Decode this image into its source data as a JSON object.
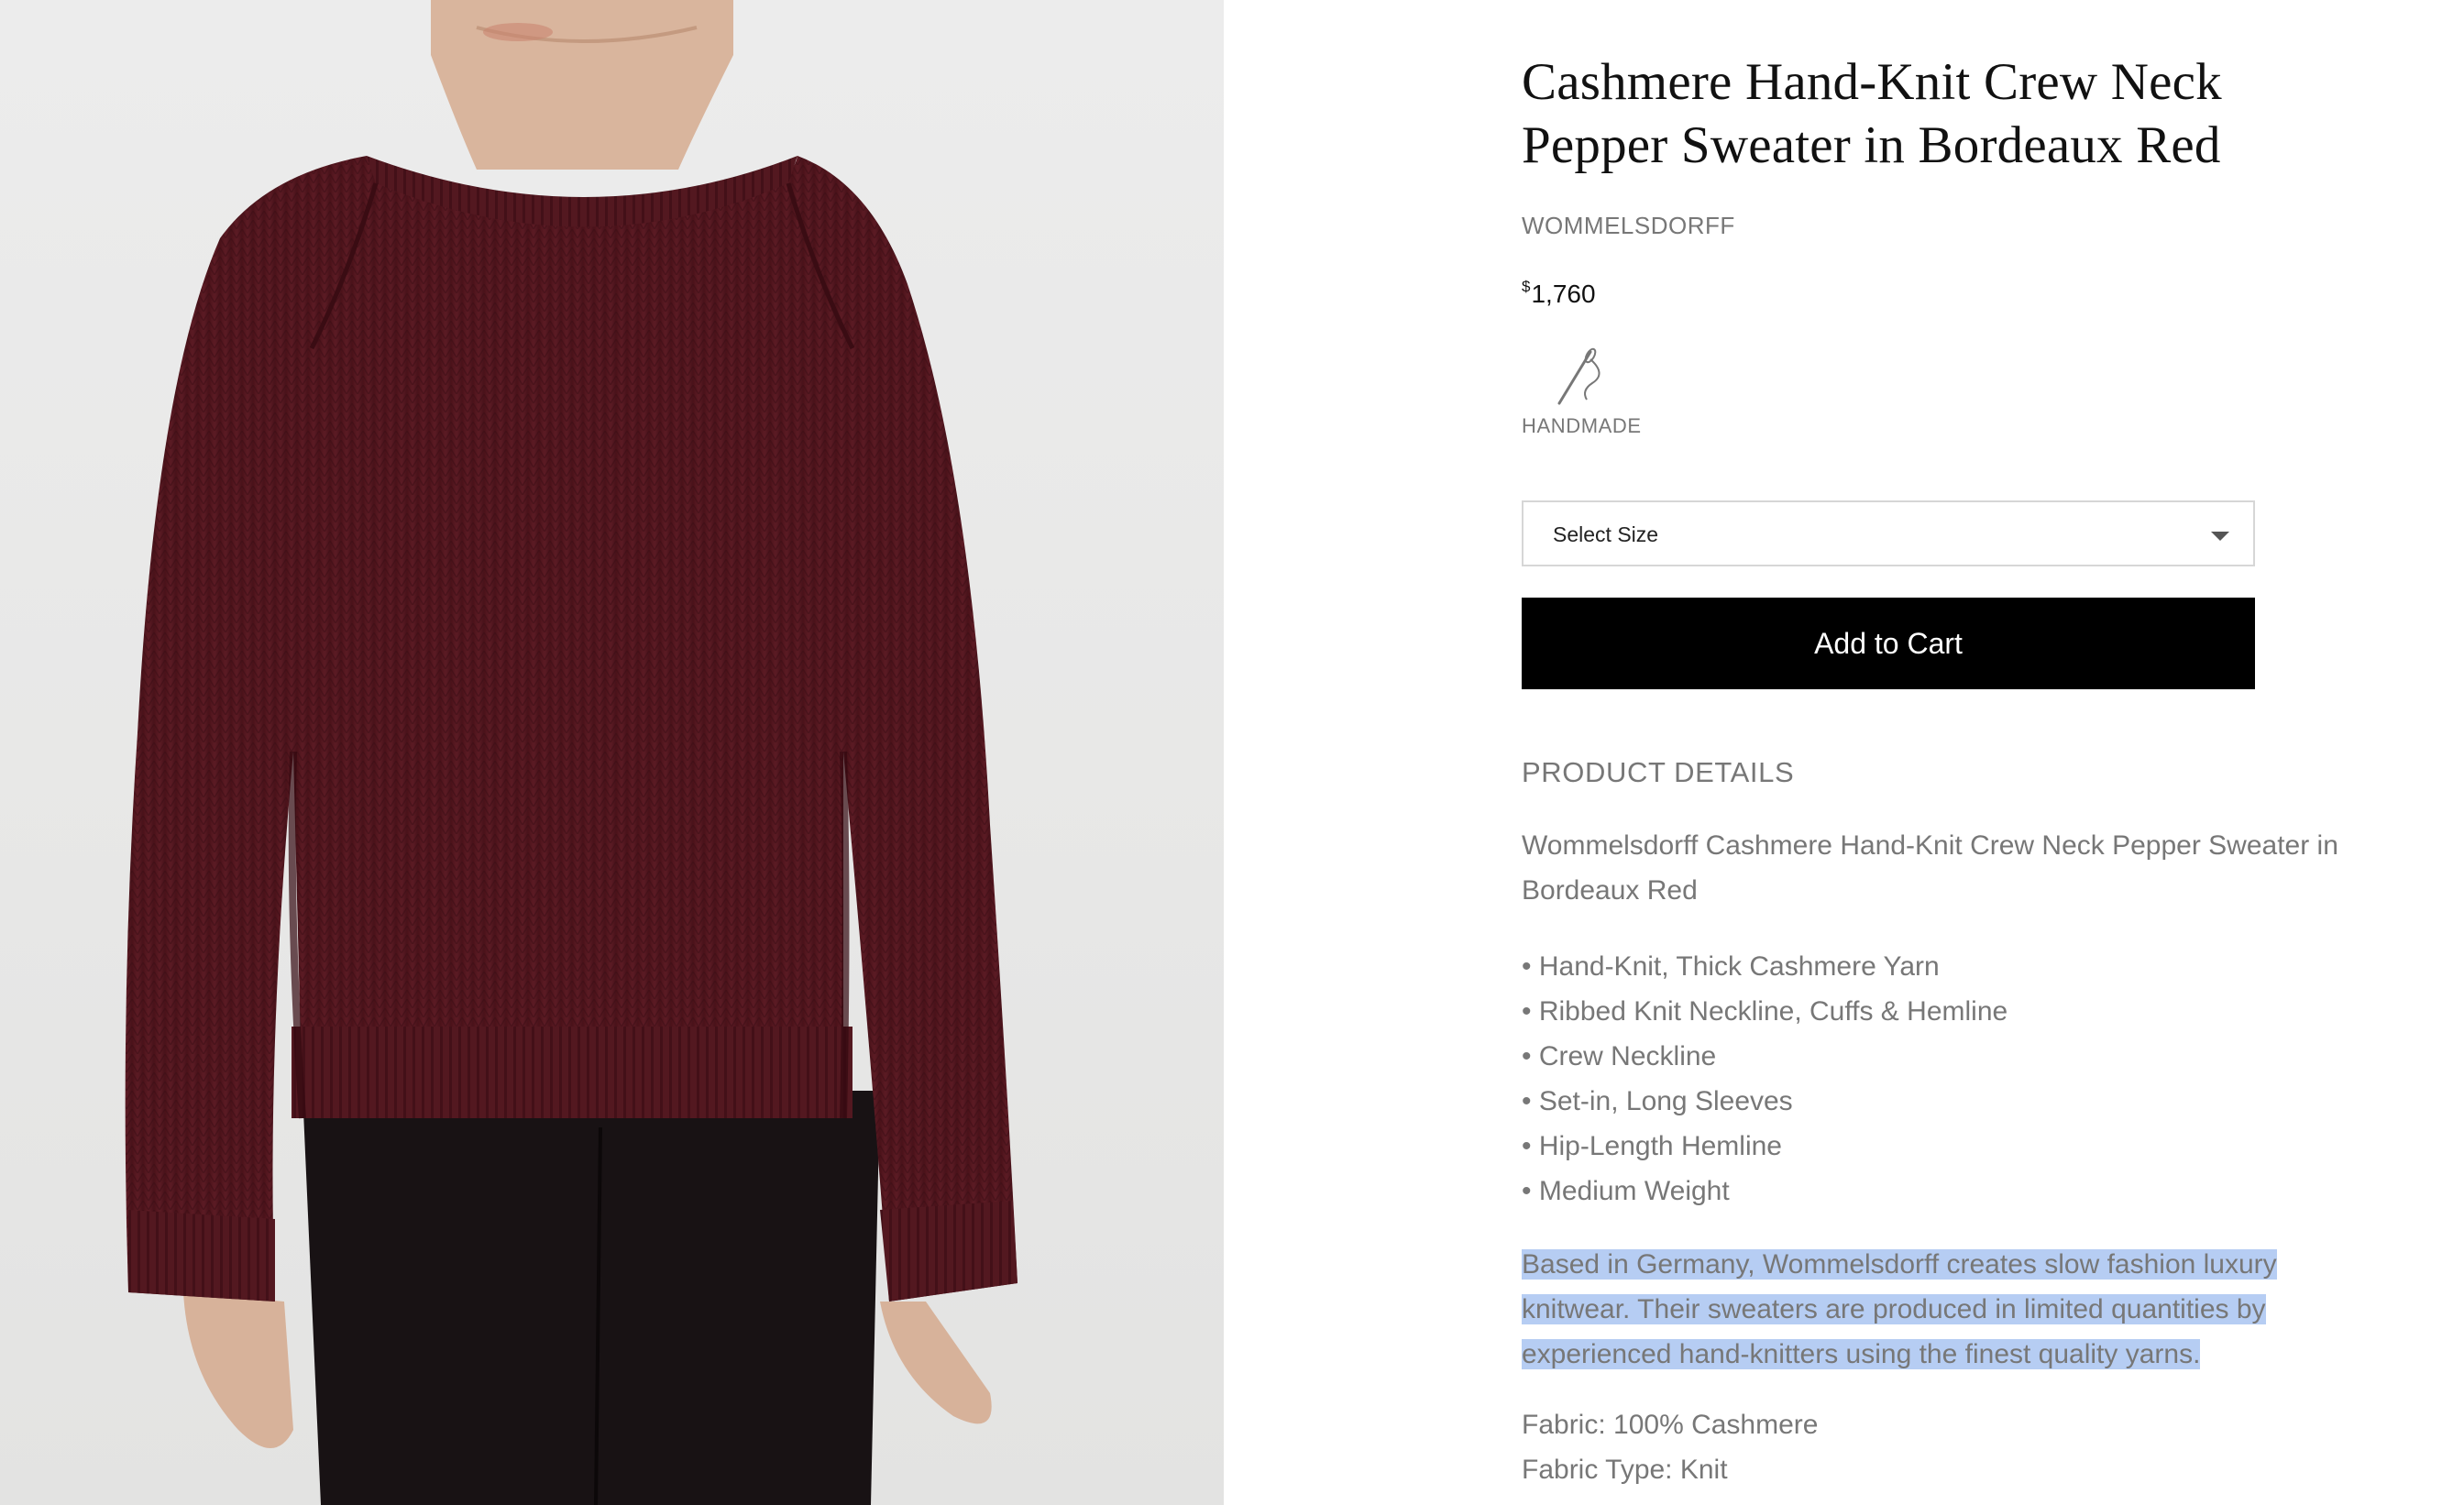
{
  "product": {
    "title": "Cashmere Hand-Knit Crew Neck Pepper Sweater in Bordeaux Red",
    "brand": "WOMMELSDORFF",
    "price_symbol": "$",
    "price_value": "1,760",
    "badge_label": "HANDMADE",
    "badge_icon": "needle-icon"
  },
  "size_select": {
    "value": "Select Size"
  },
  "cart_button": {
    "label": "Add to Cart"
  },
  "details": {
    "heading": "PRODUCT DETAILS",
    "intro": "Wommelsdorff Cashmere Hand-Knit Crew Neck Pepper Sweater in Bordeaux Red",
    "bullets": [
      "Hand-Knit, Thick Cashmere Yarn",
      "Ribbed Knit Neckline, Cuffs & Hemline",
      "Crew Neckline",
      "Set-in, Long Sleeves",
      "Hip-Length Hemline",
      "Medium Weight"
    ],
    "about": "Based in Germany, Wommelsdorff creates slow fashion luxury knitwear. Their sweaters are produced in limited quantities by experienced hand-knitters using the finest quality yarns.",
    "fabric": "Fabric: 100% Cashmere",
    "fabric_type": "Fabric Type: Knit"
  },
  "colors": {
    "sweater": "#5a1a22",
    "text_gray": "#777777",
    "selection": "#b6cdf3",
    "button": "#000000"
  }
}
